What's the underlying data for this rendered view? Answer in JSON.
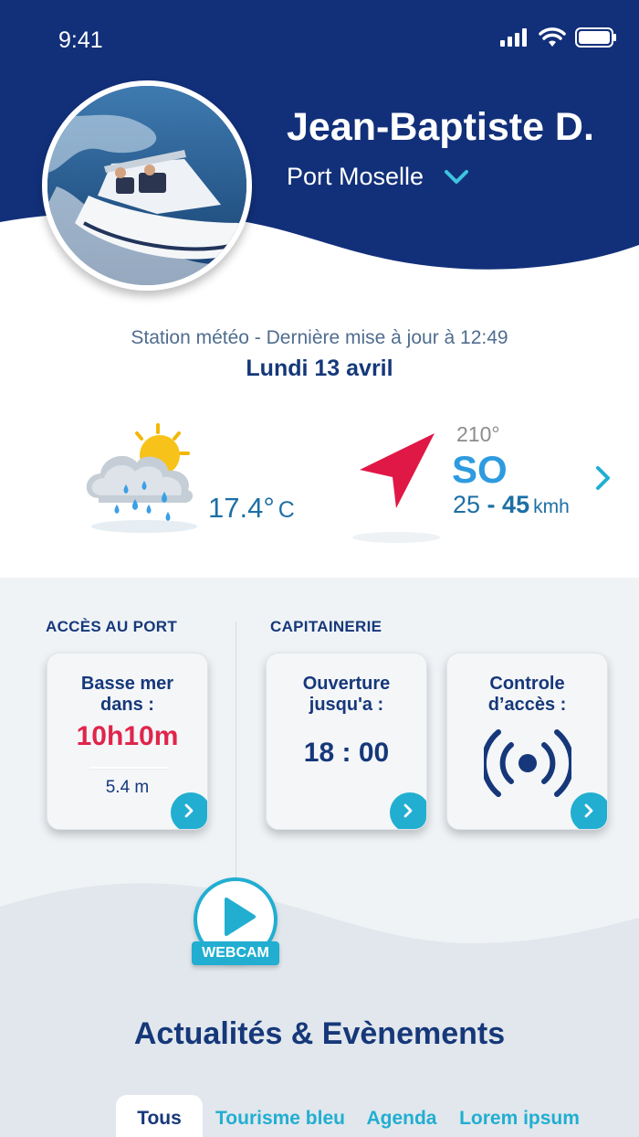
{
  "status_bar": {
    "time": "9:41"
  },
  "profile": {
    "name": "Jean-Baptiste D.",
    "port": "Port Moselle"
  },
  "weather": {
    "subtitle": "Station météo - Dernière mise à jour à 12:49",
    "date": "Lundi 13 avril",
    "temperature": "17.4°",
    "temperature_unit": "C",
    "wind_degrees": "210°",
    "wind_direction": "SO",
    "wind_min": "25",
    "wind_sep": " - ",
    "wind_max": "45",
    "wind_unit": "kmh"
  },
  "access": {
    "section_label": "ACCÈS AU PORT",
    "card": {
      "title_line1": "Basse mer",
      "title_line2": "dans :",
      "value": "10h10m",
      "sub": "5.4 m"
    }
  },
  "harbor": {
    "section_label": "CAPITAINERIE",
    "opening_card": {
      "title_line1": "Ouverture",
      "title_line2": "jusqu'a :",
      "value": "18 : 00"
    },
    "control_card": {
      "title_line1": "Controle",
      "title_line2": "d’accès :"
    }
  },
  "webcam": {
    "label": "WEBCAM"
  },
  "news": {
    "title": "Actualités & Evènements",
    "tabs": [
      {
        "label": "Tous",
        "active": true
      },
      {
        "label": "Tourisme bleu",
        "active": false
      },
      {
        "label": "Agenda",
        "active": false
      },
      {
        "label": "Lorem ipsum",
        "active": false
      }
    ]
  },
  "colors": {
    "header_navy": "#12307a",
    "accent_cyan": "#21aed1",
    "alert_red": "#e0254b",
    "text_navy": "#16387a"
  }
}
